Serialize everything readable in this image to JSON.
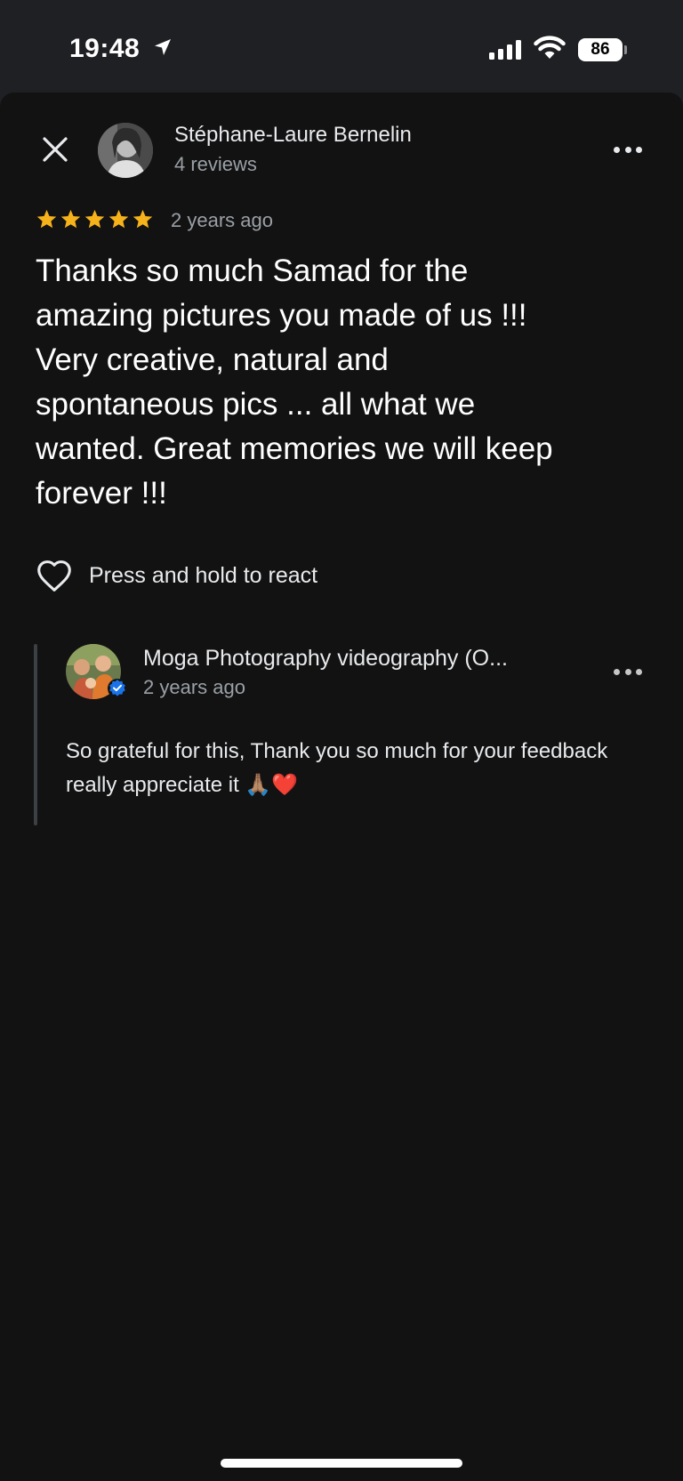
{
  "status_bar": {
    "time": "19:48",
    "battery": "86",
    "icons": [
      "location-arrow-icon",
      "cellular-signal-icon",
      "wifi-icon",
      "battery-icon"
    ]
  },
  "review": {
    "reviewer_name": "Stéphane-Laure Bernelin",
    "reviewer_sub": "4 reviews",
    "rating": 5,
    "time": "2 years ago",
    "text": "Thanks so much Samad for the\namazing pictures you made of us !!!\nVery creative,  natural and\nspontaneous pics ... all what we\nwanted. Great memories we will keep\nforever !!!",
    "react_label": "Press and hold to react"
  },
  "owner_reply": {
    "name": "Moga Photography videography (O...",
    "time": "2 years ago",
    "text": "So grateful for this, Thank you so much for your feedback really appreciate it 🙏🏽❤️"
  },
  "colors": {
    "star": "#f6b21b",
    "background": "#121212",
    "verified": "#1a73e8"
  }
}
